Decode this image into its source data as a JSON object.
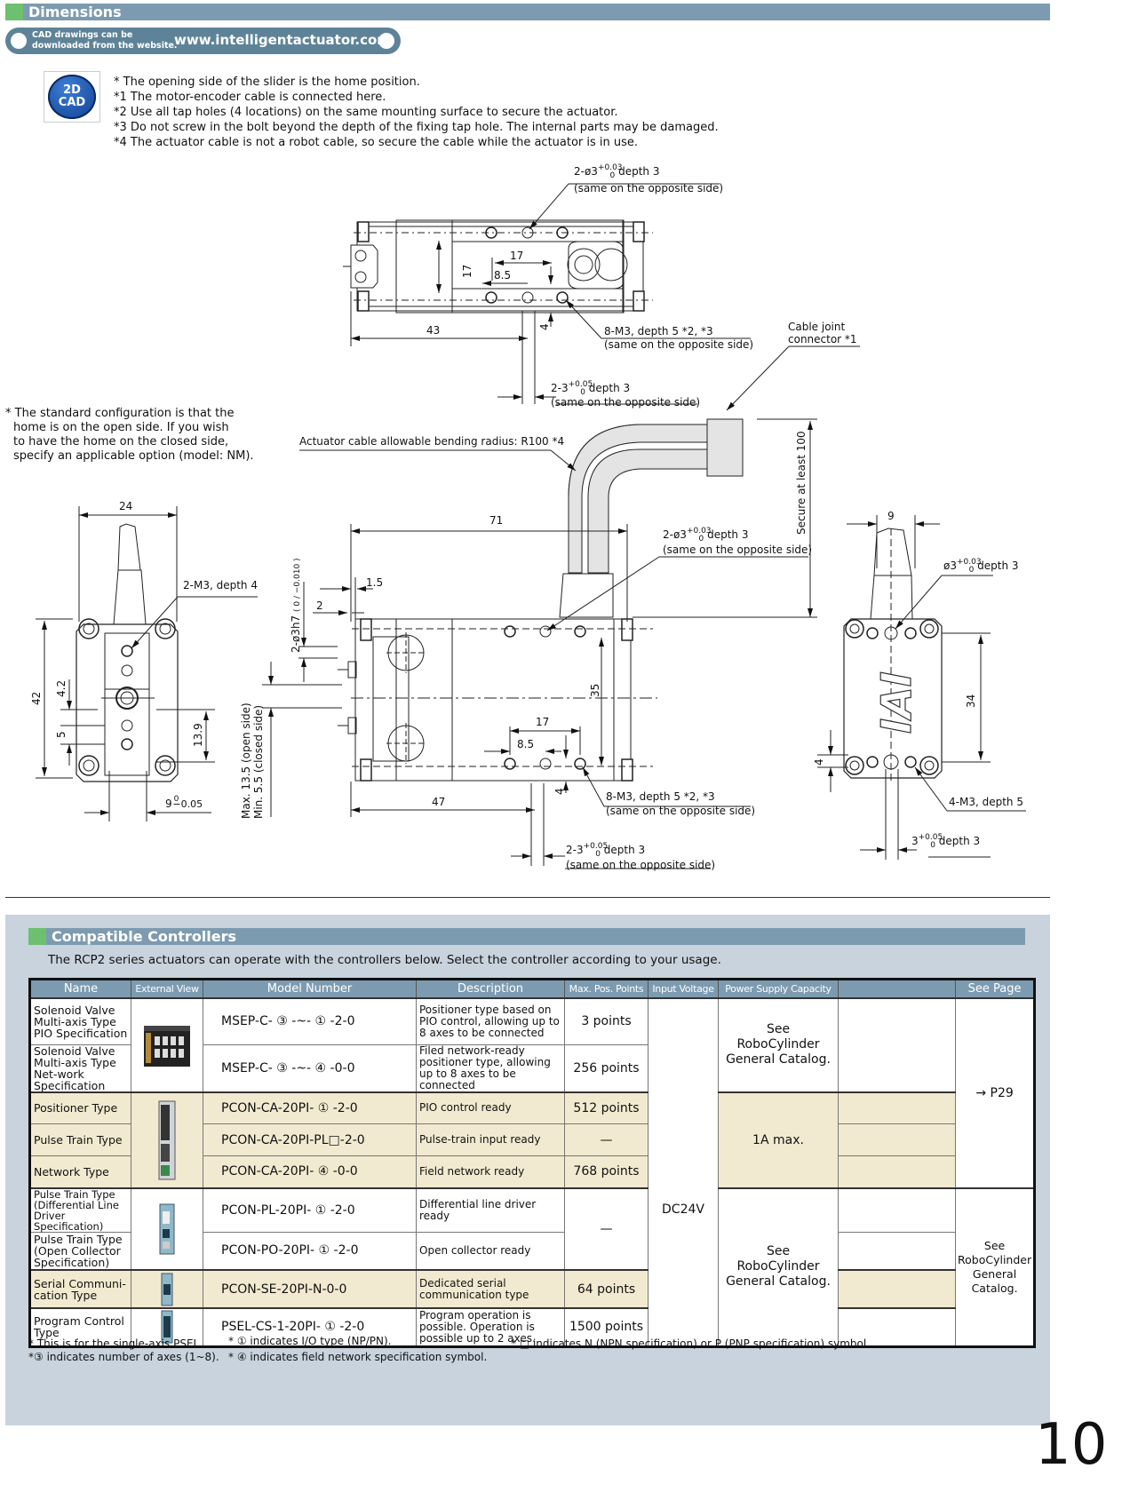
{
  "section_title": "Dimensions",
  "cad_banner": {
    "note_line1": "CAD drawings can be",
    "note_line2": "downloaded from the website.",
    "url": "www.intelligentactuator.com"
  },
  "cad_icon": {
    "line1": "2D",
    "line2": "CAD"
  },
  "notes": [
    "* The opening side of the slider is the home position.",
    "*1 The motor-encoder cable is connected here.",
    "*2 Use all tap holes (4 locations) on the same mounting surface to secure the actuator.",
    "*3 Do not screw in the bolt beyond the depth of the fixing tap hole. The internal parts may be damaged.",
    "*4 The actuator cable is not a robot cable, so secure the cable while the actuator is in use."
  ],
  "home_note": [
    "* The standard configuration is that the",
    "home is on the open side. If you wish",
    "to have the home on the closed side,",
    "specify an applicable option (model: NM)."
  ],
  "drawing": {
    "top_view": {
      "pin_hole_label": "2-ø3",
      "pin_hole_tol_upper": "+0.03",
      "pin_hole_tol_lower": "0",
      "pin_hole_depth": "depth 3",
      "same_opposite": "(same on the opposite side)",
      "tap_label": "8-M3, depth 5  *2, *3",
      "slot_label": "2-3",
      "slot_tol_upper": "+0.05",
      "slot_tol_lower": "0",
      "slot_depth": "depth 3",
      "dim_43": "43",
      "dim_17_h": "17",
      "dim_17_v": "17",
      "dim_8_5": "8.5",
      "dim_4": "4",
      "cable_joint": [
        "Cable joint",
        "connector *1"
      ]
    },
    "side_view": {
      "bend_label": "Actuator cable allowable bending radius: R100 *4",
      "secure_label": "Secure at least 100",
      "dim_71": "71",
      "dim_47": "47",
      "dim_35": "35",
      "dim_17": "17",
      "dim_8_5": "8.5",
      "dim_4": "4",
      "dim_1_5": "1.5",
      "dim_2": "2",
      "shaft_label": "2-ø3h7",
      "shaft_tol": "( 0 / −0.010 )",
      "stroke_max": "Max. 13.5 (open side)",
      "stroke_min": "Min. 5.5 (closed side)",
      "pin_hole_label": "2-ø3",
      "pin_hole_tol_upper": "+0.03",
      "pin_hole_tol_lower": "0",
      "pin_hole_depth": "depth 3",
      "same_opposite": "(same on the opposite side)",
      "tap_label": "8-M3, depth 5  *2, *3",
      "slot_label": "2-3",
      "slot_tol_upper": "+0.05",
      "slot_tol_lower": "0",
      "slot_depth": "depth 3"
    },
    "end_view": {
      "dim_24": "24",
      "dim_42": "42",
      "dim_4_2": "4.2",
      "dim_5": "5",
      "dim_13_9": "13.9",
      "dim_9": "9",
      "dim_9_tol_upper": "0",
      "dim_9_tol_lower": "−0.05",
      "tap_label": "2-M3, depth 4"
    },
    "right_view": {
      "dim_9": "9",
      "dim_34": "34",
      "dim_4": "4",
      "pin_label": "ø3",
      "pin_tol_upper": "+0.03",
      "pin_tol_lower": "0",
      "pin_depth": "depth 3",
      "tap_label": "4-M3, depth 5",
      "slot_label": "3",
      "slot_tol_upper": "+0.05",
      "slot_tol_lower": "0",
      "slot_depth": "depth 3",
      "logo": "IAI"
    }
  },
  "controllers": {
    "title": "Compatible Controllers",
    "intro": "The RCP2 series actuators can operate with the controllers below. Select the controller according to your usage.",
    "headers": [
      "Name",
      "External View",
      "Model Number",
      "Description",
      "Max. Pos. Points",
      "Input Voltage",
      "Power Supply Capacity",
      "",
      "See Page"
    ],
    "rows": [
      {
        "name": "Solenoid Valve Multi-axis Type PIO Specification",
        "model": "MSEP-C- ③ -~- ① -2-0",
        "description": "Positioner type based on PIO control, allowing up to 8 axes to be connected",
        "points": "3 points"
      },
      {
        "name": "Solenoid Valve Multi-axis Type Net-work Specification",
        "model": "MSEP-C- ③ -~- ④ -0-0",
        "description": "Filed network-ready positioner type, allowing up to 8 axes to be connected",
        "points": "256 points"
      },
      {
        "name": "Positioner Type",
        "model": "PCON-CA-20PI- ① -2-0",
        "description": "PIO control ready",
        "points": "512 points"
      },
      {
        "name": "Pulse Train Type",
        "model": "PCON-CA-20PI-PL□-2-0",
        "description": "Pulse-train input ready",
        "points": "—"
      },
      {
        "name": "Network Type",
        "model": "PCON-CA-20PI- ④ -0-0",
        "description": "Field network ready",
        "points": "768 points"
      },
      {
        "name": "Pulse Train Type (Differential Line Driver Specification)",
        "model": "PCON-PL-20PI- ① -2-0",
        "description": "Differential line driver ready",
        "points": "—"
      },
      {
        "name": "Pulse Train Type (Open Collector Specification)",
        "model": "PCON-PO-20PI- ① -2-0",
        "description": "Open collector ready",
        "points": ""
      },
      {
        "name": "Serial Communi-cation Type",
        "model": "PCON-SE-20PI-N-0-0",
        "description": "Dedicated serial communication type",
        "points": "64 points"
      },
      {
        "name": "Program Control Type",
        "model": "PSEL-CS-1-20PI- ① -2-0",
        "description": "Program operation is possible. Operation is possible up to 2 axes.",
        "points": "1500 points"
      }
    ],
    "input_voltage": "DC24V",
    "power_msep": "See RoboCylinder General Catalog.",
    "power_pcon_ca": "1A max.",
    "power_other": "See RoboCylinder General Catalog.",
    "see_page_top": "→ P29",
    "see_page_bottom": "See RoboCylinder General Catalog.",
    "footnotes": [
      "* This is for the single-axis PSEL.",
      "*③ indicates number of axes (1~8).",
      "* ① indicates I/O type (NP/PN).",
      "* ④ indicates field network specification symbol.",
      "* □ indicates N (NPN specification) or P (PNP specification) symbol."
    ]
  },
  "colors": {
    "header_blue": "#7d9bb0",
    "accent_green": "#6cc06f",
    "panel_gray": "#c8d3dd",
    "beige_row": "#f2ead0",
    "pill_blue": "#5e8398"
  },
  "page_number": "10"
}
